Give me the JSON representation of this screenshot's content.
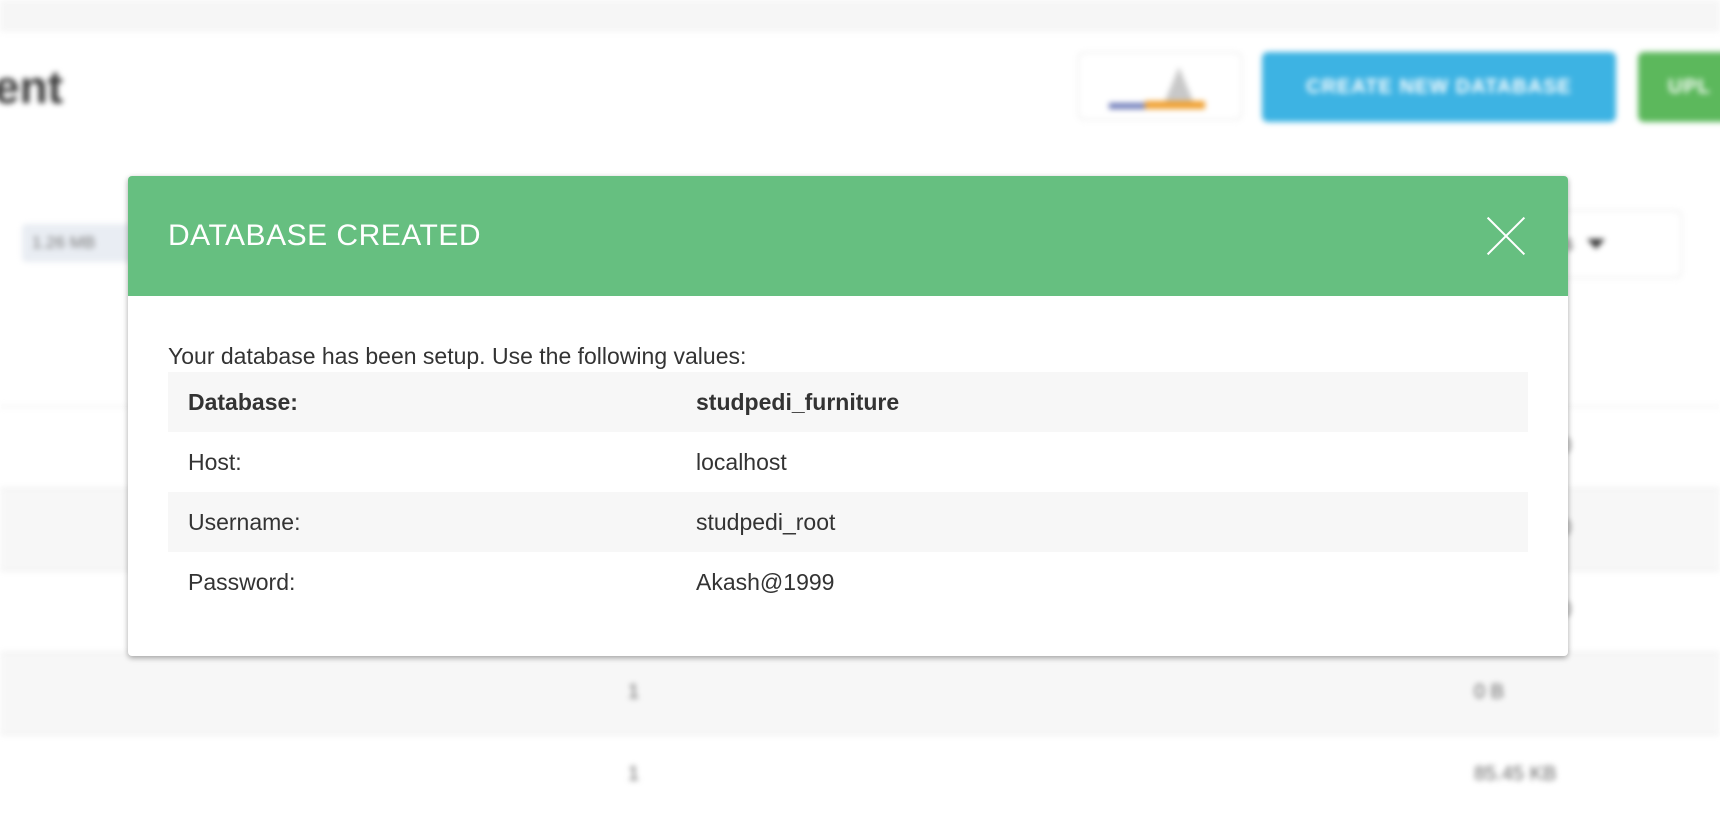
{
  "background": {
    "page_title": "ent",
    "buttons": {
      "create_database": "CREATE NEW DATABASE",
      "upload": "UPL"
    },
    "size_chip": "1.26 MB",
    "columns_label": "nns",
    "rows": [
      {
        "count": "",
        "size": "0"
      },
      {
        "count": "",
        "size": "0"
      },
      {
        "count": "",
        "size": "0"
      },
      {
        "count": "1",
        "size": "0 B"
      },
      {
        "count": "1",
        "size": "85.45 KB"
      }
    ],
    "colors": {
      "create_button": "#3db3e3",
      "upload_button": "#5cb85c"
    }
  },
  "modal": {
    "title": "DATABASE CREATED",
    "close_icon": "close-icon",
    "intro": "Your database has been setup. Use the following values:",
    "fields": [
      {
        "label": "Database:",
        "value": "studpedi_furniture"
      },
      {
        "label": "Host:",
        "value": "localhost"
      },
      {
        "label": "Username:",
        "value": "studpedi_root"
      },
      {
        "label": "Password:",
        "value": "Akash@1999"
      }
    ],
    "colors": {
      "header": "#66bf80"
    }
  }
}
